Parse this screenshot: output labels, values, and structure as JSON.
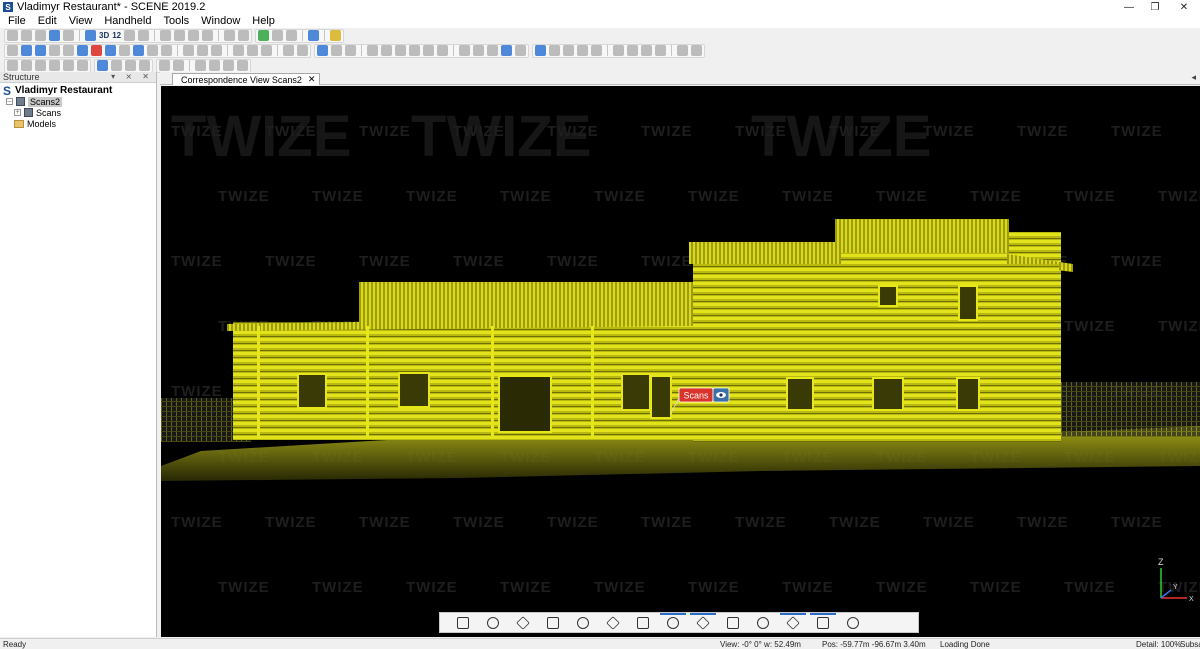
{
  "window": {
    "title": "Vladimyr Restaurant* - SCENE 2019.2",
    "app_icon": "S",
    "minimize": "—",
    "maximize": "❐",
    "close": "✕"
  },
  "menu": [
    "File",
    "Edit",
    "View",
    "Handheld",
    "Tools",
    "Window",
    "Help"
  ],
  "toolbar1": {
    "groups": [
      [
        "grey",
        "grey",
        "grey",
        "blue",
        "grey",
        "sep",
        "blue",
        "3D",
        "12",
        "grey",
        "grey",
        "sep",
        "grey",
        "grey",
        "grey",
        "grey",
        "sep",
        "grey",
        "grey"
      ],
      [
        "green",
        "grey",
        "grey",
        "sep",
        "blue",
        "sep",
        "yellow"
      ],
      []
    ],
    "label_3d": "3D",
    "label_12": "12"
  },
  "toolbar2": {
    "groups": [
      [
        "grey",
        "blue",
        "blue",
        "grey",
        "grey",
        "blue",
        "red",
        "blue",
        "grey",
        "blue",
        "grey",
        "grey",
        "sep",
        "grey",
        "grey",
        "grey",
        "sep",
        "grey",
        "grey",
        "grey",
        "sep",
        "grey",
        "grey"
      ],
      [
        "blue",
        "grey",
        "grey",
        "sep",
        "grey",
        "grey",
        "grey",
        "grey",
        "grey",
        "grey",
        "sep",
        "grey",
        "grey",
        "grey",
        "blue",
        "grey"
      ],
      [
        "blue",
        "grey",
        "grey",
        "grey",
        "grey",
        "sep",
        "grey",
        "grey",
        "grey",
        "grey",
        "sep",
        "grey",
        "grey"
      ]
    ]
  },
  "toolbar3": {
    "groups": [
      [
        "grey",
        "grey",
        "grey",
        "grey",
        "grey",
        "grey"
      ],
      [
        "blue",
        "grey",
        "grey",
        "grey"
      ],
      [
        "grey",
        "grey",
        "sep",
        "grey",
        "grey",
        "grey",
        "grey"
      ]
    ]
  },
  "structure": {
    "header": "Structure",
    "controls": "▾ ⨯ ✕",
    "root": "Vladimyr Restaurant",
    "scans2": "Scans2",
    "scans": "Scans",
    "models": "Models"
  },
  "tabs": [
    {
      "label": "Correspondence View Scans2",
      "close": "✕"
    }
  ],
  "tab_scroll": "◂",
  "viewport": {
    "watermark": "TWIZE",
    "big_watermark": "TWIZE",
    "scan_label": "Scans",
    "axis_z": "Z",
    "axis_y": "Y",
    "axis_x": "X"
  },
  "view_toolbar": {
    "buttons": [
      {
        "icon": "hand-icon",
        "active": false
      },
      {
        "icon": "camera-box-icon",
        "active": false
      },
      {
        "icon": "zoom-icon",
        "active": false
      },
      {
        "icon": "cube-outline-icon",
        "active": false
      },
      {
        "icon": "rotate-icon",
        "active": false
      },
      {
        "icon": "pin-icon",
        "active": false
      },
      {
        "icon": "pin-list-icon",
        "active": false
      },
      {
        "icon": "scan-filter-icon",
        "active": true
      },
      {
        "icon": "refresh-icon",
        "active": true
      },
      {
        "icon": "split-icon",
        "active": false
      },
      {
        "icon": "clip-icon",
        "active": false
      },
      {
        "icon": "box-icon",
        "active": true
      },
      {
        "icon": "grid-select-icon",
        "active": true
      },
      {
        "icon": "more-icon",
        "active": false
      }
    ]
  },
  "status": {
    "ready": "Ready",
    "view": "View: -0° 0° w: 52.49m",
    "pos": "Pos: -59.77m -96.67m 3.40m",
    "loading": "Loading Done",
    "detail": "Detail: 100%",
    "subsample": "Subsa"
  },
  "colors": {
    "scan_yellow": "#e6e619",
    "scan_label_red": "#d9332b",
    "watermark": "#1e1e1e",
    "toolbar_blue": "#3a7bd5",
    "toolbar_grey": "#8c8c8c"
  }
}
